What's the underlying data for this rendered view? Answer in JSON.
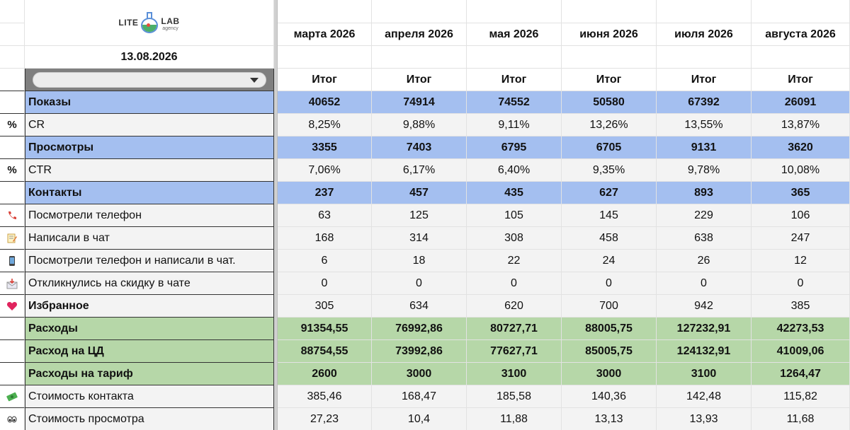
{
  "header": {
    "logo_left": "LITE",
    "logo_right": "LAB",
    "logo_sub": "agency",
    "date": "13.08.2026",
    "months": [
      "марта 2026",
      "апреля 2026",
      "мая 2026",
      "июня 2026",
      "июля 2026",
      "августа 2026"
    ],
    "total_label": "Итог"
  },
  "filter": {
    "selected": ""
  },
  "rows": [
    {
      "icon": "",
      "label": "Показы",
      "values": [
        "40652",
        "74914",
        "74552",
        "50580",
        "67392",
        "26091"
      ]
    },
    {
      "icon": "%",
      "label": "CR",
      "values": [
        "8,25%",
        "9,88%",
        "9,11%",
        "13,26%",
        "13,55%",
        "13,87%"
      ]
    },
    {
      "icon": "",
      "label": "Просмотры",
      "values": [
        "3355",
        "7403",
        "6795",
        "6705",
        "9131",
        "3620"
      ]
    },
    {
      "icon": "%",
      "label": "CTR",
      "values": [
        "7,06%",
        "6,17%",
        "6,40%",
        "9,35%",
        "9,78%",
        "10,08%"
      ]
    },
    {
      "icon": "",
      "label": "Контакты",
      "values": [
        "237",
        "457",
        "435",
        "627",
        "893",
        "365"
      ]
    },
    {
      "icon": "phone-icon",
      "label": "Посмотрели телефон",
      "values": [
        "63",
        "125",
        "105",
        "145",
        "229",
        "106"
      ]
    },
    {
      "icon": "memo-icon",
      "label": "Написали в чат",
      "values": [
        "168",
        "314",
        "308",
        "458",
        "638",
        "247"
      ]
    },
    {
      "icon": "mobile-icon",
      "label": "Посмотрели телефон и написали в чат.",
      "values": [
        "6",
        "18",
        "22",
        "24",
        "26",
        "12"
      ]
    },
    {
      "icon": "envelope-icon",
      "label": "Откликнулись на скидку в чате",
      "values": [
        "0",
        "0",
        "0",
        "0",
        "0",
        "0"
      ]
    },
    {
      "icon": "heart-icon",
      "label": "Избранное",
      "values": [
        "305",
        "634",
        "620",
        "700",
        "942",
        "385"
      ]
    },
    {
      "icon": "",
      "label": "Расходы",
      "values": [
        "91354,55",
        "76992,86",
        "80727,71",
        "88005,75",
        "127232,91",
        "42273,53"
      ]
    },
    {
      "icon": "",
      "label": "Расход на ЦД",
      "values": [
        "88754,55",
        "73992,86",
        "77627,71",
        "85005,75",
        "124132,91",
        "41009,06"
      ]
    },
    {
      "icon": "",
      "label": "Расходы на тариф",
      "values": [
        "2600",
        "3000",
        "3100",
        "3000",
        "3100",
        "1264,47"
      ]
    },
    {
      "icon": "money-icon",
      "label": "Стоимость контакта",
      "values": [
        "385,46",
        "168,47",
        "185,58",
        "140,36",
        "142,48",
        "115,82"
      ]
    },
    {
      "icon": "eyes-icon",
      "label": "Стоимость просмотра",
      "values": [
        "27,23",
        "10,4",
        "11,88",
        "13,13",
        "13,93",
        "11,68"
      ]
    }
  ],
  "colors": {
    "blue_band": "#a4bff0",
    "green_band": "#b6d7a8",
    "gray_band": "#f3f3f3"
  }
}
